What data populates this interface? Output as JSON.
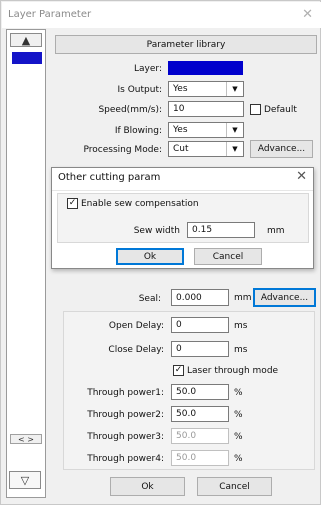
{
  "window": {
    "title": "Layer Parameter",
    "close": "✕"
  },
  "sidebar": {
    "scroll_up": "▲",
    "scroll_down": "▽",
    "left_right": "< >"
  },
  "header": {
    "param_library": "Parameter library"
  },
  "form": {
    "layer_label": "Layer:",
    "layer_color": "#0000cc",
    "is_output_label": "Is Output:",
    "is_output_value": "Yes",
    "speed_label": "Speed(mm/s):",
    "speed_value": "10",
    "default_label": "Default",
    "if_blowing_label": "If Blowing:",
    "if_blowing_value": "Yes",
    "processing_mode_label": "Processing Mode:",
    "processing_mode_value": "Cut",
    "advance_label": "Advance..."
  },
  "dialog": {
    "title": "Other cutting param",
    "close": "✕",
    "enable_sew_label": "Enable sew compensation",
    "enable_sew_checked": true,
    "sew_width_label": "Sew width",
    "sew_width_value": "0.15",
    "sew_width_unit": "mm",
    "ok": "Ok",
    "cancel": "Cancel"
  },
  "lower": {
    "seal_label": "Seal:",
    "seal_value": "0.000",
    "seal_unit": "mm",
    "advance_label": "Advance...",
    "open_delay_label": "Open Delay:",
    "open_delay_value": "0",
    "open_delay_unit": "ms",
    "close_delay_label": "Close Delay:",
    "close_delay_value": "0",
    "close_delay_unit": "ms",
    "laser_through_label": "Laser through mode",
    "laser_through_checked": true,
    "power1_label": "Through power1:",
    "power1_value": "50.0",
    "power2_label": "Through power2:",
    "power2_value": "50.0",
    "power3_label": "Through power3:",
    "power3_value": "50.0",
    "power4_label": "Through power4:",
    "power4_value": "50.0",
    "percent": "%"
  },
  "footer": {
    "ok": "Ok",
    "cancel": "Cancel"
  }
}
